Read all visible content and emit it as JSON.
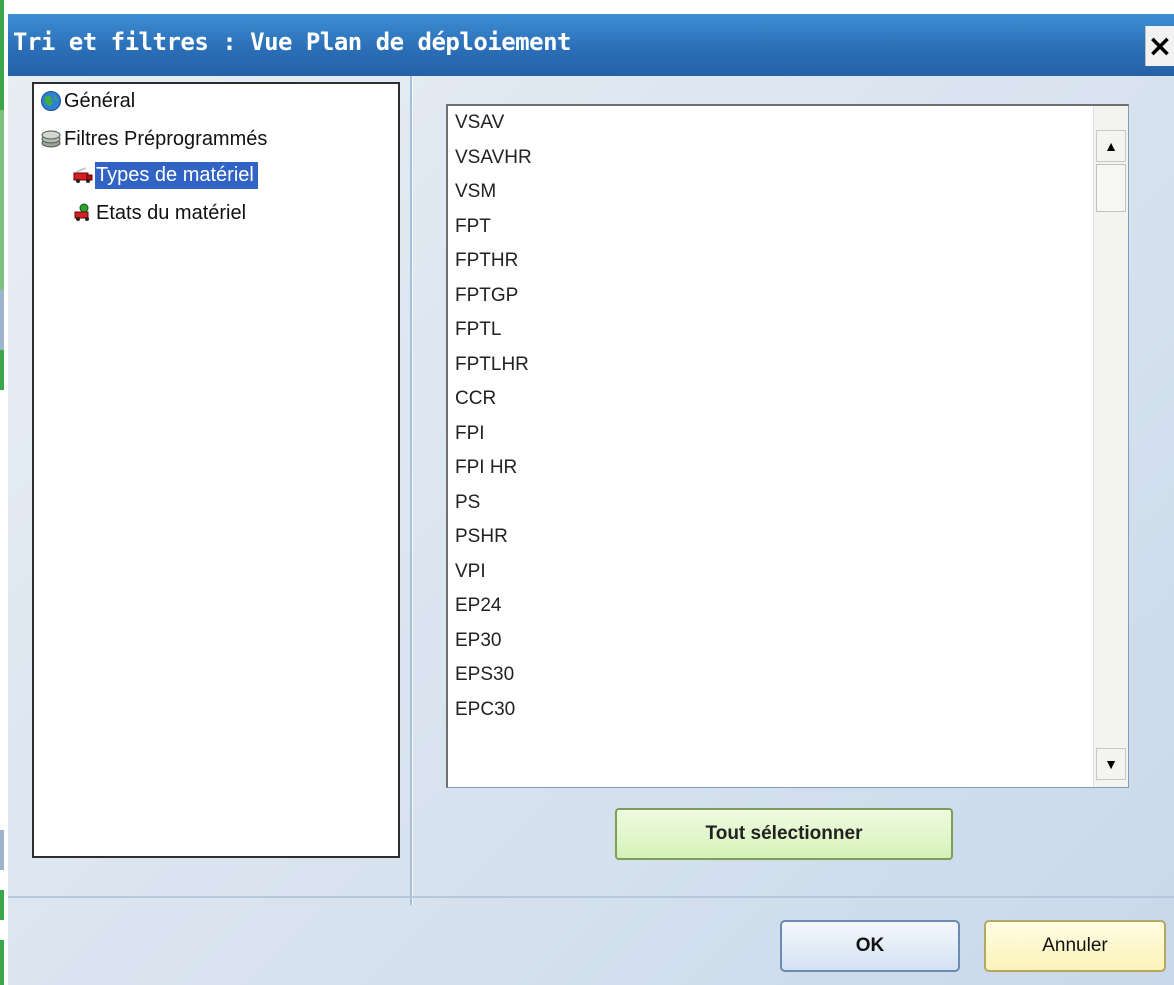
{
  "window": {
    "title": "Tri et filtres : Vue Plan de déploiement",
    "close_label": "×"
  },
  "tree": {
    "items": [
      {
        "label": "Général",
        "icon": "globe-icon",
        "selected": false,
        "level": 0
      },
      {
        "label": "Filtres Préprogrammés",
        "icon": "stack-icon",
        "selected": false,
        "level": 0
      },
      {
        "label": "Types de matériel",
        "icon": "truck-icon",
        "selected": true,
        "level": 1
      },
      {
        "label": "Etats du matériel",
        "icon": "status-icon",
        "selected": false,
        "level": 1
      }
    ]
  },
  "list": {
    "items": [
      "VSAV",
      "VSAVHR",
      "VSM",
      "FPT",
      "FPTHR",
      "FPTGP",
      "FPTL",
      "FPTLHR",
      "CCR",
      "FPI",
      "FPI HR",
      "PS",
      "PSHR",
      "VPI",
      "EP24",
      "EP30",
      "EPS30",
      "EPC30"
    ],
    "scroll_up_glyph": "▲",
    "scroll_down_glyph": "▼"
  },
  "buttons": {
    "select_all": "Tout sélectionner",
    "ok": "OK",
    "cancel": "Annuler"
  },
  "colors": {
    "titlebar": "#2b6fb8",
    "selection": "#3163c5",
    "select_all_bg": "#d6f1b8",
    "cancel_bg": "#fbf2b9"
  }
}
